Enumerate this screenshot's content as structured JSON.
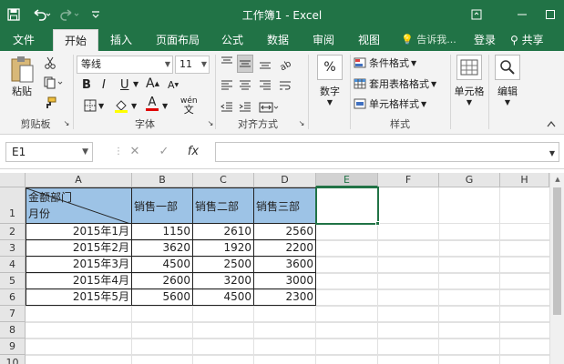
{
  "window": {
    "title": "工作簿1 - Excel",
    "controls": [
      "restore-ribbon",
      "minimize",
      "maximize"
    ]
  },
  "tabs": [
    {
      "label": "文件",
      "active": false
    },
    {
      "label": "开始",
      "active": true
    },
    {
      "label": "插入",
      "active": false
    },
    {
      "label": "页面布局",
      "active": false
    },
    {
      "label": "公式",
      "active": false
    },
    {
      "label": "数据",
      "active": false
    },
    {
      "label": "审阅",
      "active": false
    },
    {
      "label": "视图",
      "active": false
    }
  ],
  "tell_me": "告诉我...",
  "sign_in": "登录",
  "share": "共享",
  "ribbon": {
    "clipboard": {
      "paste": "粘贴",
      "label": "剪贴板"
    },
    "font": {
      "name": "等线",
      "size": "11",
      "label": "字体",
      "bold": "B",
      "italic": "I",
      "underline": "U",
      "grow": "A",
      "shrink": "A",
      "font_color": "A",
      "wen": "wén"
    },
    "alignment": {
      "label": "对齐方式"
    },
    "number": {
      "label": "数字"
    },
    "styles": {
      "label": "样式",
      "conditional": "条件格式",
      "table": "套用表格格式",
      "cell_styles": "单元格样式"
    },
    "cells": {
      "label": "单元格"
    },
    "editing": {
      "label": "编辑"
    }
  },
  "formula_bar": {
    "name_box": "E1",
    "cancel": "✕",
    "enter": "✓",
    "fx": "fx",
    "formula": ""
  },
  "sheet": {
    "columns": [
      "A",
      "B",
      "C",
      "D",
      "E",
      "F",
      "G",
      "H"
    ],
    "selected_column": "E",
    "rows": [
      "1",
      "2",
      "3",
      "4",
      "5",
      "6",
      "7",
      "8",
      "9",
      "10"
    ],
    "header": {
      "a1_top": "金额部门",
      "a1_bottom": "月份",
      "b1": "销售一部",
      "c1": "销售二部",
      "d1": "销售三部"
    },
    "data": [
      {
        "month": "2015年1月",
        "b": "1150",
        "c": "2610",
        "d": "2560"
      },
      {
        "month": "2015年2月",
        "b": "3620",
        "c": "1920",
        "d": "2200"
      },
      {
        "month": "2015年3月",
        "b": "4500",
        "c": "2500",
        "d": "3600"
      },
      {
        "month": "2015年4月",
        "b": "2600",
        "c": "3200",
        "d": "3000"
      },
      {
        "month": "2015年5月",
        "b": "5600",
        "c": "4500",
        "d": "2300"
      }
    ],
    "active_cell": "E1"
  },
  "colors": {
    "excel_green": "#217346",
    "header_fill": "#9dc3e6"
  }
}
